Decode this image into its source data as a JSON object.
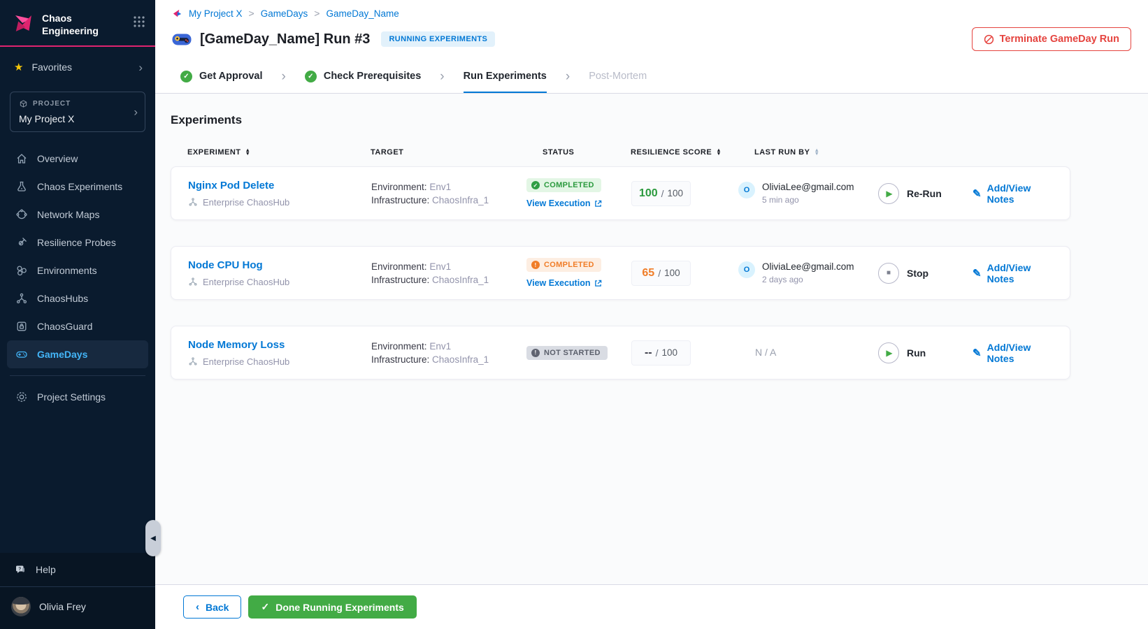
{
  "sidebar": {
    "brand": {
      "line1": "Chaos",
      "line2": "Engineering"
    },
    "favorites_label": "Favorites",
    "project": {
      "label": "PROJECT",
      "name": "My Project X"
    },
    "nav": [
      {
        "label": "Overview"
      },
      {
        "label": "Chaos Experiments"
      },
      {
        "label": "Network Maps"
      },
      {
        "label": "Resilience Probes"
      },
      {
        "label": "Environments"
      },
      {
        "label": "ChaosHubs"
      },
      {
        "label": "ChaosGuard"
      },
      {
        "label": "GameDays"
      }
    ],
    "project_settings_label": "Project Settings",
    "help_label": "Help",
    "user_name": "Olivia Frey"
  },
  "header": {
    "breadcrumb": {
      "items": [
        "My Project X",
        "GameDays",
        "GameDay_Name"
      ],
      "separator": ">"
    },
    "title": "[GameDay_Name] Run #3",
    "badge": "RUNNING EXPERIMENTS",
    "terminate_label": "Terminate GameDay Run"
  },
  "stepper": {
    "steps": [
      {
        "label": "Get Approval",
        "state": "done"
      },
      {
        "label": "Check Prerequisites",
        "state": "done"
      },
      {
        "label": "Run Experiments",
        "state": "active"
      },
      {
        "label": "Post-Mortem",
        "state": "upcoming"
      }
    ]
  },
  "experiments": {
    "heading": "Experiments",
    "columns": {
      "experiment": "EXPERIMENT",
      "target": "TARGET",
      "status": "STATUS",
      "score": "RESILIENCE SCORE",
      "last_run": "LAST RUN BY"
    },
    "score_sep": "/",
    "rows": [
      {
        "name": "Nginx Pod Delete",
        "hub": "Enterprise ChaosHub",
        "env_label": "Environment:",
        "env_value": "Env1",
        "infra_label": "Infrastructure:",
        "infra_value": "ChaosInfra_1",
        "status": "COMPLETED",
        "view_execution": "View Execution",
        "score": "100",
        "score_max": "100",
        "avatar_initial": "O",
        "run_by": "OliviaLee@gmail.com",
        "run_time": "5 min ago",
        "action": "Re-Run",
        "notes": "Add/View Notes"
      },
      {
        "name": "Node CPU Hog",
        "hub": "Enterprise ChaosHub",
        "env_label": "Environment:",
        "env_value": "Env1",
        "infra_label": "Infrastructure:",
        "infra_value": "ChaosInfra_1",
        "status": "COMPLETED",
        "view_execution": "View Execution",
        "score": "65",
        "score_max": "100",
        "avatar_initial": "O",
        "run_by": "OliviaLee@gmail.com",
        "run_time": "2 days ago",
        "action": "Stop",
        "notes": "Add/View Notes"
      },
      {
        "name": "Node Memory Loss",
        "hub": "Enterprise ChaosHub",
        "env_label": "Environment:",
        "env_value": "Env1",
        "infra_label": "Infrastructure:",
        "infra_value": "ChaosInfra_1",
        "status": "NOT STARTED",
        "score": "--",
        "score_max": "100",
        "not_applicable": "N / A",
        "action": "Run",
        "notes": "Add/View Notes"
      }
    ]
  },
  "footer": {
    "back_label": "Back",
    "done_label": "Done Running Experiments"
  },
  "colors": {
    "accent_blue": "#0278d5",
    "success_green": "#42ab45",
    "warning_orange": "#f07d28",
    "danger_red": "#e5443f",
    "brand_magenta": "#e0246f",
    "sidebar_bg": "#0a1b2e",
    "active_nav_blue": "#43b5f8"
  }
}
